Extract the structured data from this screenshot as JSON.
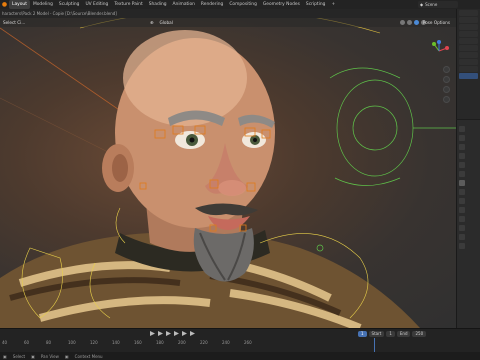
{
  "title_strip": "haracters\\Pack 2 Model - Copie [D:\\Source\\Blender.blend]",
  "menu": [
    "Layout",
    "Modeling",
    "Sculpting",
    "UV Editing",
    "Texture Paint",
    "Shading",
    "Animation",
    "Rendering",
    "Compositing",
    "Geometry Nodes",
    "Scripting",
    "+"
  ],
  "scene_label": "Scene",
  "viewport": {
    "select_label": "Select Ci...",
    "mode_label": "Global",
    "pose_options": "Pose Options"
  },
  "timeline": {
    "frame_current": "1",
    "start_label": "Start",
    "start_value": "1",
    "end_label": "End",
    "end_value": "250",
    "ruler": [
      "40",
      "60",
      "80",
      "100",
      "120",
      "140",
      "160",
      "180",
      "200",
      "220",
      "240",
      "260"
    ]
  },
  "status": {
    "item1": "Select",
    "item2": "Pan View",
    "item3": "Context Menu"
  }
}
